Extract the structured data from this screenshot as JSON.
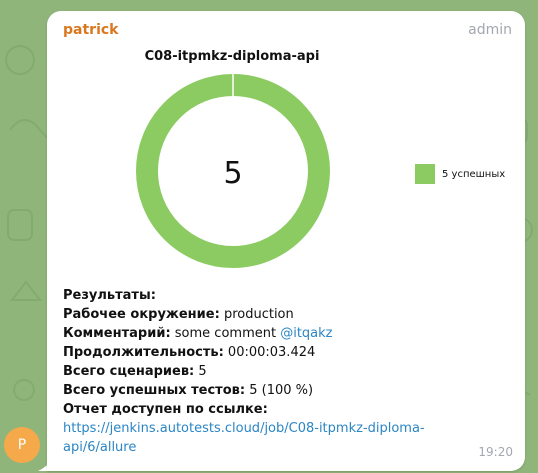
{
  "message": {
    "sender": "patrick",
    "sender_role": "admin",
    "avatar_letter": "P",
    "time": "19:20"
  },
  "chart_data": {
    "type": "pie",
    "title": "C08-itpmkz-diploma-api",
    "center_label": "5",
    "categories": [
      "5 успешных"
    ],
    "values": [
      5
    ],
    "colors": [
      "#8bcb61"
    ],
    "legend": "right"
  },
  "report": {
    "results_label": "Результаты:",
    "env_label": "Рабочее окружение:",
    "env_value": "production",
    "comment_label": "Комментарий:",
    "comment_value": "some comment",
    "comment_mention": "@itqakz",
    "duration_label": "Продолжительность:",
    "duration_value": "00:00:03.424",
    "scenarios_label": "Всего сценариев:",
    "scenarios_value": "5",
    "passed_label": "Всего успешных тестов:",
    "passed_value": "5 (100 %)",
    "link_label": "Отчет доступен по ссылке:",
    "link_line1": "https://jenkins.autotests.cloud/job/C08-itpmkz-diploma-",
    "link_line2": "api/6/allure"
  }
}
